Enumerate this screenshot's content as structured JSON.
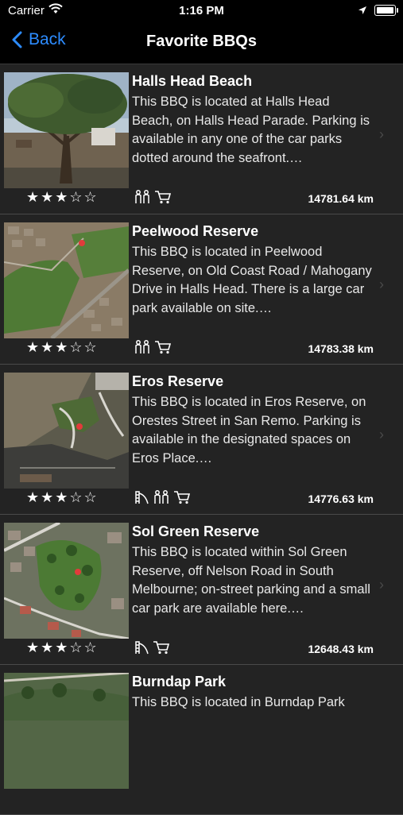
{
  "status": {
    "carrier": "Carrier",
    "time": "1:16 PM"
  },
  "nav": {
    "back_label": "Back",
    "title": "Favorite BBQs"
  },
  "items": [
    {
      "title": "Halls Head Beach",
      "desc": "This BBQ is located at Halls Head Beach, on Halls Head Parade. Parking is available in any one of the car parks dotted around the seafront.…",
      "rating": 3,
      "stars": "★★★☆☆",
      "amenities": [
        "toilets-icon",
        "cart-icon"
      ],
      "distance": "14781.64 km"
    },
    {
      "title": "Peelwood Reserve",
      "desc": "This BBQ is located in Peelwood Reserve, on Old Coast Road / Mahogany Drive in Halls Head. There is a large car park available on site.…",
      "rating": 3,
      "stars": "★★★☆☆",
      "amenities": [
        "toilets-icon",
        "cart-icon"
      ],
      "distance": "14783.38 km"
    },
    {
      "title": "Eros Reserve",
      "desc": "This BBQ is located in Eros Reserve, on Orestes Street in San Remo. Parking is available in the designated spaces on Eros Place.…",
      "rating": 3,
      "stars": "★★★☆☆",
      "amenities": [
        "playground-icon",
        "toilets-icon",
        "cart-icon"
      ],
      "distance": "14776.63 km"
    },
    {
      "title": "Sol Green Reserve",
      "desc": "This BBQ is located within Sol Green Reserve, off Nelson Road in South Melbourne; on-street parking and a small car park are available here.…",
      "rating": 3,
      "stars": "★★★☆☆",
      "amenities": [
        "playground-icon",
        "cart-icon"
      ],
      "distance": "12648.43 km"
    },
    {
      "title": "Burndap Park",
      "desc": "This BBQ is located in Burndap Park",
      "rating": null,
      "stars": "",
      "amenities": [],
      "distance": ""
    }
  ]
}
